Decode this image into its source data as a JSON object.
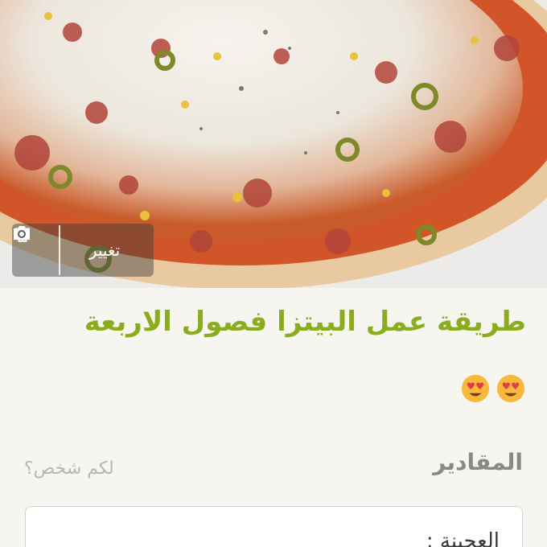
{
  "photo": {
    "description_icon": "pizza-photo",
    "toolbar": {
      "change_label": "تغيير",
      "camera_icon": "camera-icon",
      "delete_icon": "trash-icon"
    }
  },
  "recipe": {
    "title": "طريقة عمل البيتزا فصول الاربعة",
    "emoji": "😍😍"
  },
  "ingredients": {
    "label": "المقادير",
    "servings_placeholder": "لكم شخص؟",
    "first_line": "العجينة :"
  },
  "colors": {
    "title": "#8aad1e",
    "background": "#f7f5f0",
    "label": "#8a8a85",
    "placeholder": "#b8b6b0"
  }
}
